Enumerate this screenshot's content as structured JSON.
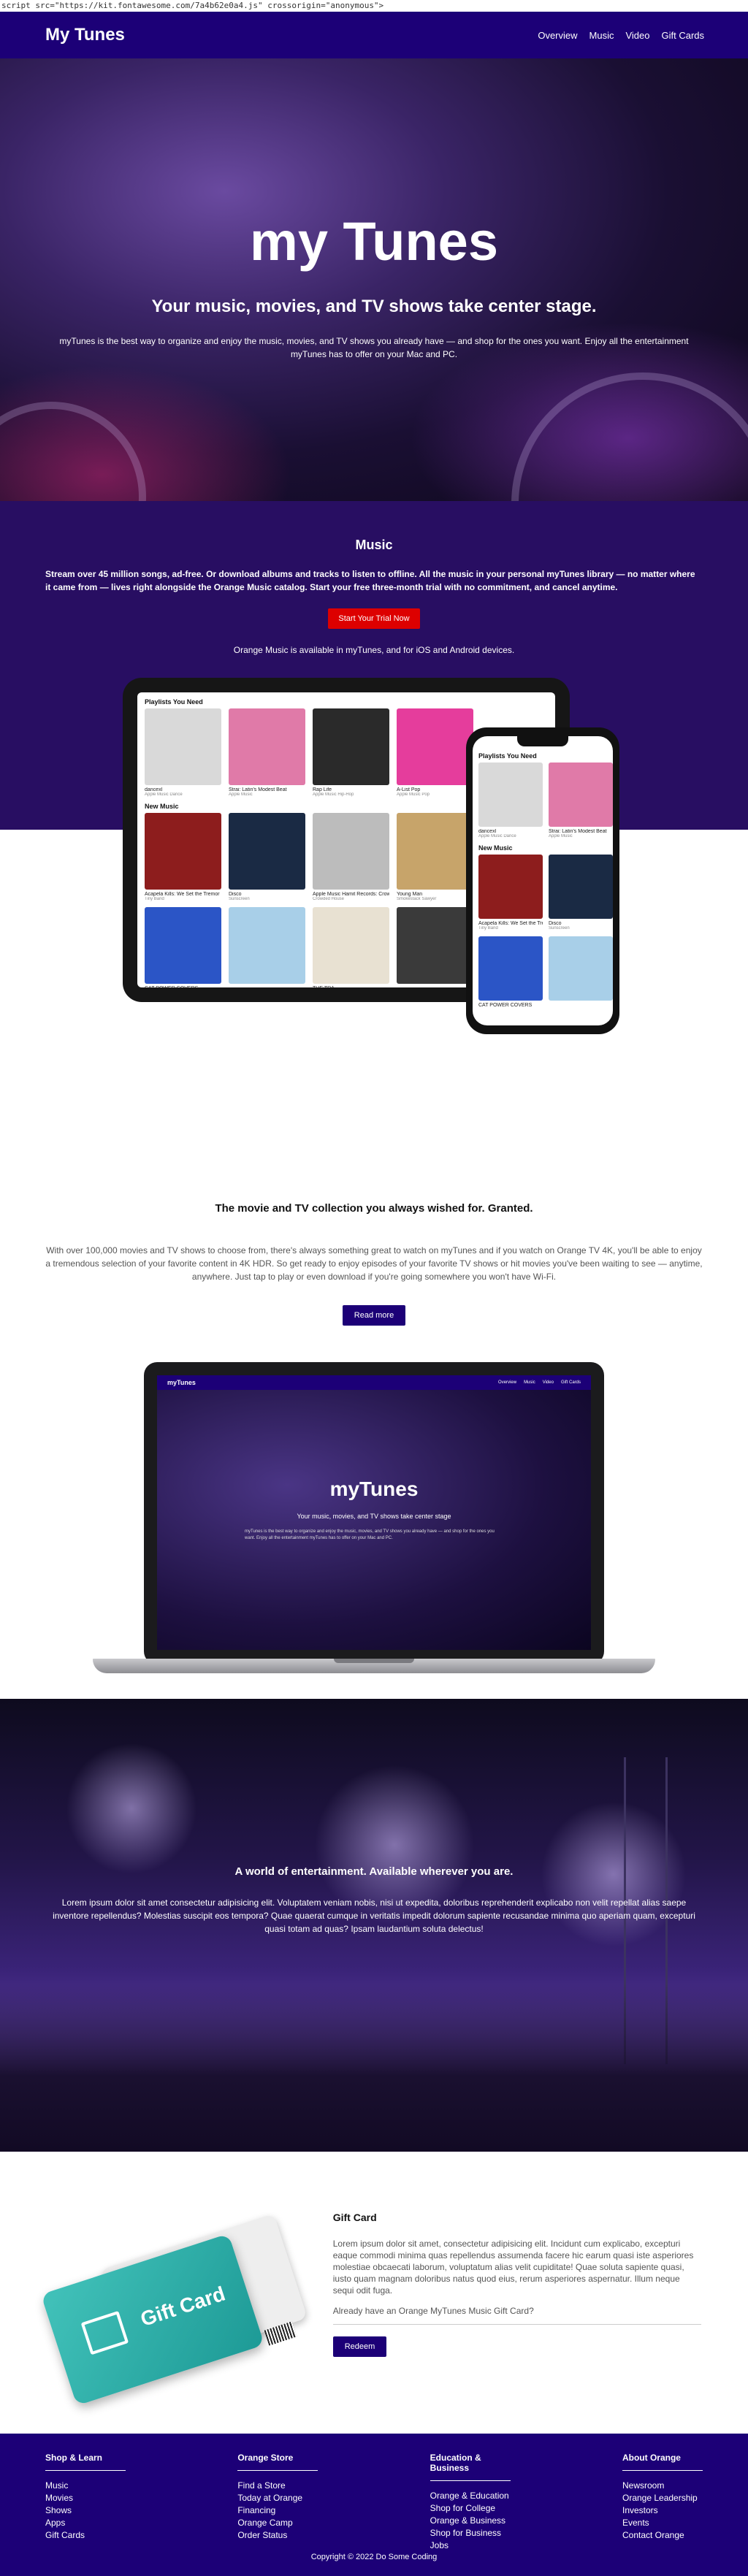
{
  "stray_text": "script src=\"https://kit.fontawesome.com/7a4b62e0a4.js\" crossorigin=\"anonymous\">",
  "nav": {
    "brand": "My Tunes",
    "links": [
      "Overview",
      "Music",
      "Video",
      "Gift Cards"
    ]
  },
  "hero": {
    "title": "my Tunes",
    "subtitle": "Your music, movies, and TV shows take center stage.",
    "description": "myTunes is the best way to organize and enjoy the music, movies, and TV shows you already have — and shop for the ones you want. Enjoy all the entertainment myTunes has to offer on your Mac and PC."
  },
  "music": {
    "title": "Music",
    "lead": "Stream over 45 million songs, ad-free. Or download albums and tracks to listen to offline. All the music in your personal myTunes library — no matter where it came from — lives right alongside the Orange Music catalog. Start your free three-month trial with no commitment, and cancel anytime.",
    "cta": "Start Your Trial Now",
    "availability": "Orange Music is available in myTunes, and for iOS and Android devices."
  },
  "devices": {
    "tablet": {
      "playlists_heading": "Playlists You Need",
      "playlists": [
        {
          "title": "dancexl",
          "sub": "Apple Music Dance",
          "color": "#d9d9d9"
        },
        {
          "title": "Strai: Latin's Modest Beat",
          "sub": "Apple Music",
          "color": "#e07aa8"
        },
        {
          "title": "Rap Life",
          "sub": "Apple Music Hip-Hop",
          "color": "#2a2a2a"
        },
        {
          "title": "A-List Pop",
          "sub": "Apple Music Pop",
          "color": "#e53d9c"
        }
      ],
      "new_heading": "New Music",
      "new_music": [
        {
          "title": "Acapela Kills: We Set the Tremor",
          "sub": "Tiny Band",
          "color": "#8d1d1d"
        },
        {
          "title": "Disco",
          "sub": "Sunscreen",
          "color": "#1a2a44"
        },
        {
          "title": "Apple Music Hamit Records: Crowded House",
          "sub": "Crowded House",
          "color": "#bcbcbc"
        },
        {
          "title": "Young Man",
          "sub": "Smokestack Sawyer",
          "color": "#c7a46a"
        }
      ],
      "bottom_row": [
        {
          "title": "CAT POWER COVERS",
          "color": "#2b55c6"
        },
        {
          "title": "",
          "color": "#a8cfe8"
        },
        {
          "title": "THE TRA",
          "color": "#e8e1d2"
        },
        {
          "title": "",
          "color": "#3a3a3a"
        }
      ]
    },
    "phone": {
      "playlists_heading": "Playlists You Need",
      "playlists": [
        {
          "title": "dancexl",
          "sub": "Apple Music Dance",
          "color": "#d9d9d9"
        },
        {
          "title": "Strai: Latin's Modest Beat",
          "sub": "Apple Music",
          "color": "#e07aa8"
        }
      ],
      "new_heading": "New Music",
      "new_music": [
        {
          "title": "Acapela Kills: We Set the Tremor",
          "sub": "Tiny Band",
          "color": "#8d1d1d"
        },
        {
          "title": "Disco",
          "sub": "Sunscreen",
          "color": "#1a2a44"
        }
      ],
      "bottom_row": [
        {
          "title": "CAT POWER COVERS",
          "color": "#2b55c6"
        },
        {
          "title": "",
          "color": "#a8cfe8"
        }
      ]
    }
  },
  "movies": {
    "title": "The movie and TV collection you always wished for. Granted.",
    "description": "With over 100,000 movies and TV shows to choose from, there's always something great to watch on myTunes and if you watch on Orange TV 4K, you'll be able to enjoy a tremendous selection of your favorite content in 4K HDR. So get ready to enjoy episodes of your favorite TV shows or hit movies you've been waiting to see — anytime, anywhere. Just tap to play or even download if you're going somewhere you won't have Wi-Fi.",
    "cta": "Read more",
    "laptop": {
      "brand": "myTunes",
      "links": [
        "Overview",
        "Music",
        "Video",
        "Gift Cards"
      ],
      "title": "myTunes",
      "subtitle": "Your music, movies, and TV shows take center stage",
      "description": "myTunes is the best way to organize and enjoy the music, movies, and TV shows you already have — and shop for the ones you want. Enjoy all the entertainment myTunes has to offer on your Mac and PC."
    }
  },
  "entertainment": {
    "title": "A world of entertainment. Available wherever you are.",
    "description": "Lorem ipsum dolor sit amet consectetur adipisicing elit. Voluptatem veniam nobis, nisi ut expedita, doloribus reprehenderit explicabo non velit repellat alias saepe inventore repellendus? Molestias suscipit eos tempora? Quae quaerat cumque in veritatis impedit dolorum sapiente recusandae minima quo aperiam quam, excepturi quasi totam ad quas? Ipsam laudantium soluta delectus!"
  },
  "gift": {
    "card_label": "Gift Card",
    "title": "Gift Card",
    "description": "Lorem ipsum dolor sit amet, consectetur adipisicing elit. Incidunt cum explicabo, excepturi eaque commodi minima quas repellendus assumenda facere hic earum quasi iste asperiores molestiae obcaecati laborum, voluptatum alias velit cupiditate! Quae soluta sapiente quasi, iusto quam magnam doloribus natus quod eius, rerum asperiores aspernatur. Illum neque sequi odit fuga.",
    "already": "Already have an Orange MyTunes Music Gift Card?",
    "cta": "Redeem"
  },
  "footer": {
    "columns": [
      {
        "heading": "Shop & Learn",
        "links": [
          "Music",
          "Movies",
          "Shows",
          "Apps",
          "Gift Cards"
        ]
      },
      {
        "heading": "Orange Store",
        "links": [
          "Find a Store",
          "Today at Orange",
          "Financing",
          "Orange Camp",
          "Order Status"
        ]
      },
      {
        "heading": "Education & Business",
        "links": [
          "Orange & Education",
          "Shop for College",
          "Orange & Business",
          "Shop for Business",
          "Jobs"
        ]
      },
      {
        "heading": "About Orange",
        "links": [
          "Newsroom",
          "Orange Leadership",
          "Investors",
          "Events",
          "Contact Orange"
        ]
      }
    ],
    "copyright": "Copyright © 2022 Do Some Coding"
  },
  "colors": {
    "navy": "#1c0077",
    "music_bg": "#280e62",
    "cta_red": "#dd0000"
  }
}
